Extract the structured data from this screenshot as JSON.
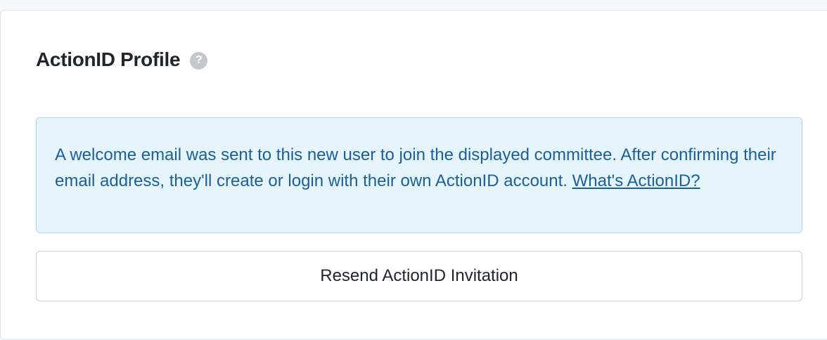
{
  "profile": {
    "title": "ActionID Profile",
    "help_icon_glyph": "?"
  },
  "notice": {
    "message": "A welcome email was sent to this new user to join the displayed committee. After confirming their email address, they'll create or login with their own ActionID account. ",
    "link_label": "What's ActionID?"
  },
  "actions": {
    "resend_label": "Resend ActionID Invitation"
  },
  "colors": {
    "info_background": "#e6f4fc",
    "info_border": "#a8d8f6",
    "info_text": "#1a5f9c",
    "help_icon": "#c4c8cd"
  }
}
